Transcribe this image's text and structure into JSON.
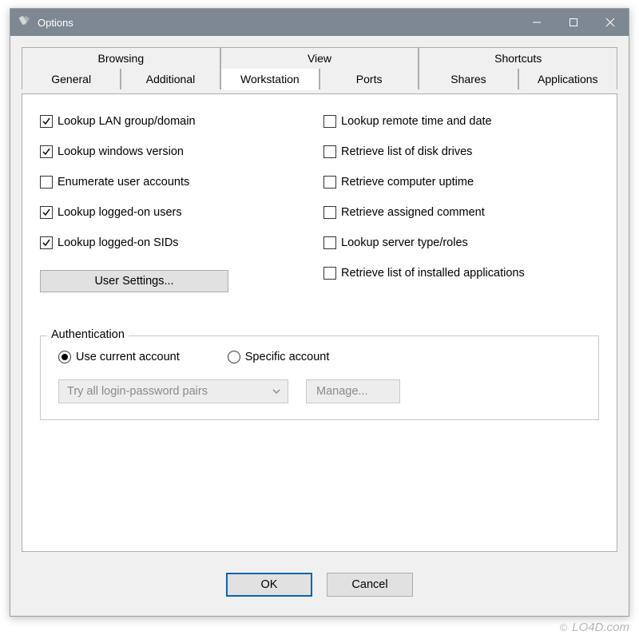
{
  "window": {
    "title": "Options"
  },
  "tabs": {
    "rowTop": [
      {
        "label": "Browsing"
      },
      {
        "label": "View"
      },
      {
        "label": "Shortcuts"
      }
    ],
    "rowBottom": [
      {
        "label": "General"
      },
      {
        "label": "Additional"
      },
      {
        "label": "Workstation",
        "active": true
      },
      {
        "label": "Ports"
      },
      {
        "label": "Shares"
      },
      {
        "label": "Applications"
      }
    ]
  },
  "options": {
    "left": [
      {
        "label": "Lookup LAN group/domain",
        "checked": true
      },
      {
        "label": "Lookup windows version",
        "checked": true
      },
      {
        "label": "Enumerate user accounts",
        "checked": false
      },
      {
        "label": "Lookup logged-on users",
        "checked": true
      },
      {
        "label": "Lookup logged-on SIDs",
        "checked": true
      }
    ],
    "right": [
      {
        "label": "Lookup remote time and date",
        "checked": false
      },
      {
        "label": "Retrieve list of disk drives",
        "checked": false
      },
      {
        "label": "Retrieve computer uptime",
        "checked": false
      },
      {
        "label": "Retrieve assigned comment",
        "checked": false
      },
      {
        "label": "Lookup server type/roles",
        "checked": false
      },
      {
        "label": "Retrieve list of installed applications",
        "checked": false
      }
    ],
    "userSettingsButton": "User Settings..."
  },
  "auth": {
    "legend": "Authentication",
    "radios": {
      "current": {
        "label": "Use current account",
        "checked": true
      },
      "specific": {
        "label": "Specific account",
        "checked": false
      }
    },
    "selectValue": "Try all login-password pairs",
    "manageButton": "Manage..."
  },
  "buttons": {
    "ok": "OK",
    "cancel": "Cancel"
  },
  "watermark": {
    "copy": "©",
    "text": "LO4D.com"
  }
}
